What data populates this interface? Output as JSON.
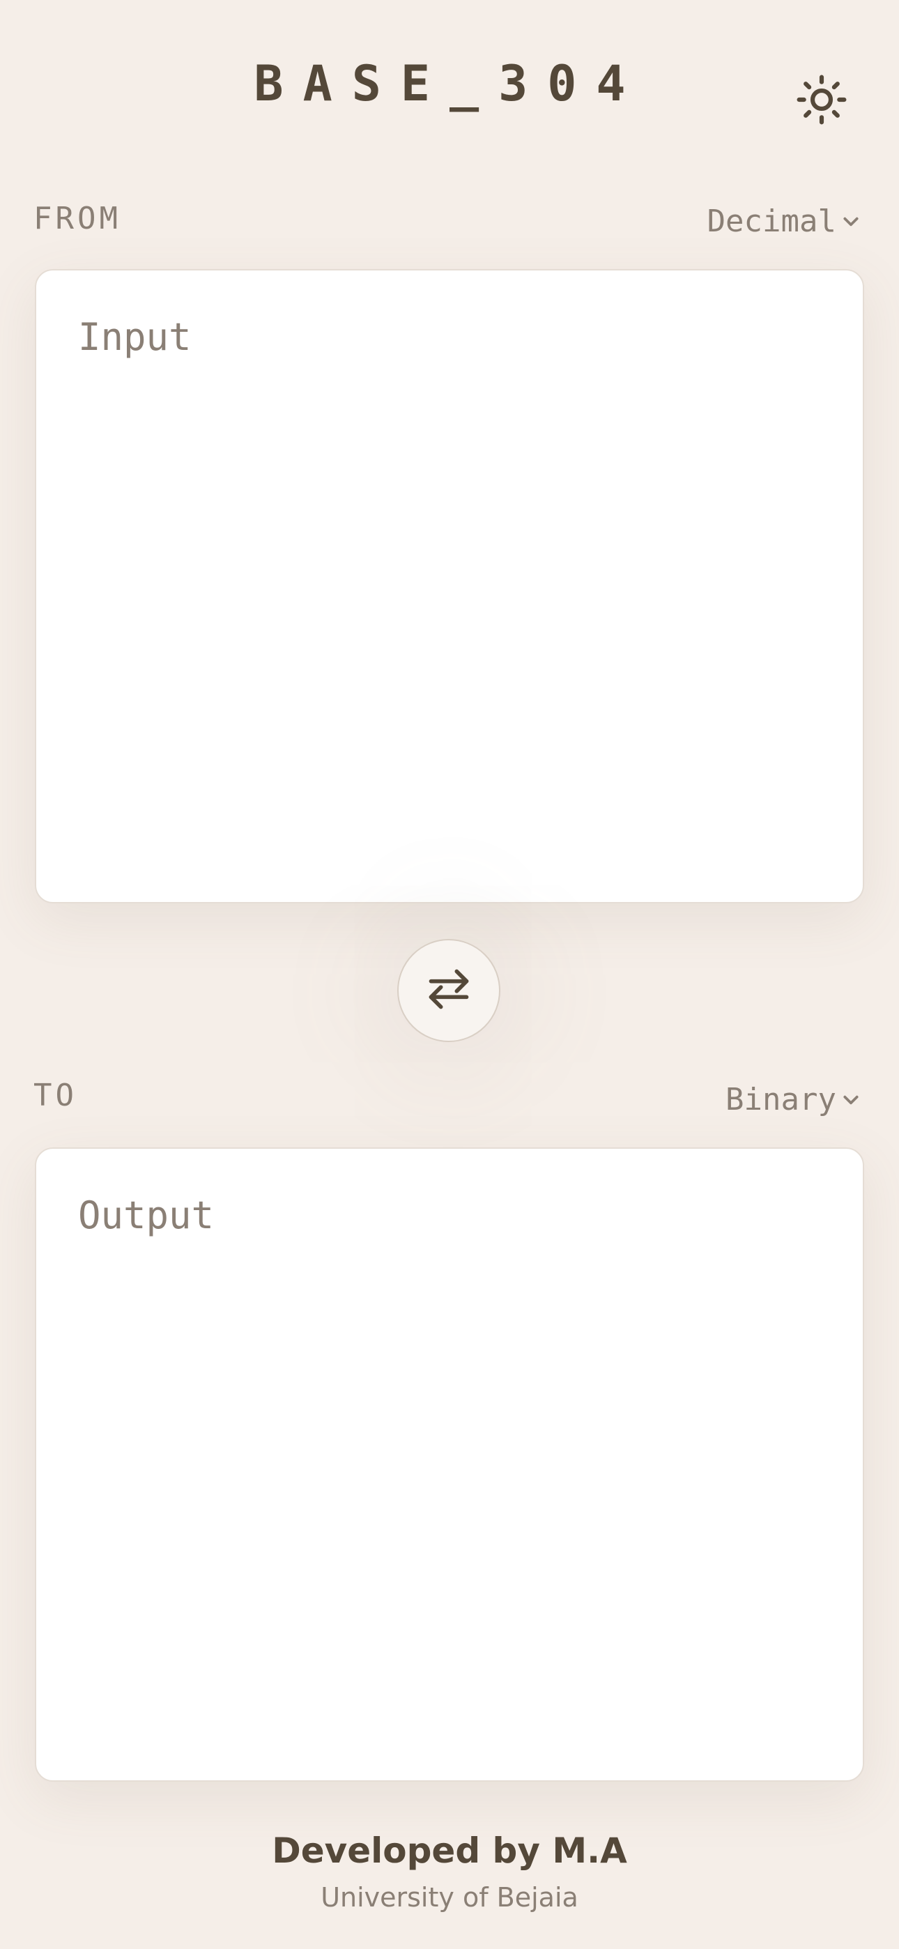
{
  "header": {
    "title": "BASE_304",
    "theme_icon": "sun-icon"
  },
  "converter": {
    "from": {
      "label": "FROM",
      "selected_base": "Decimal",
      "input_value": "",
      "input_placeholder": "Input"
    },
    "swap_icon": "swap-arrows-icon",
    "to": {
      "label": "TO",
      "selected_base": "Binary",
      "output_value": "",
      "output_placeholder": "Output"
    }
  },
  "footer": {
    "credit": "Developed by M.A",
    "affiliation": "University of Bejaia"
  },
  "colors": {
    "background": "#f5eee8",
    "text_primary": "#544839",
    "text_secondary": "#8a7f75",
    "panel": "#ffffff"
  }
}
